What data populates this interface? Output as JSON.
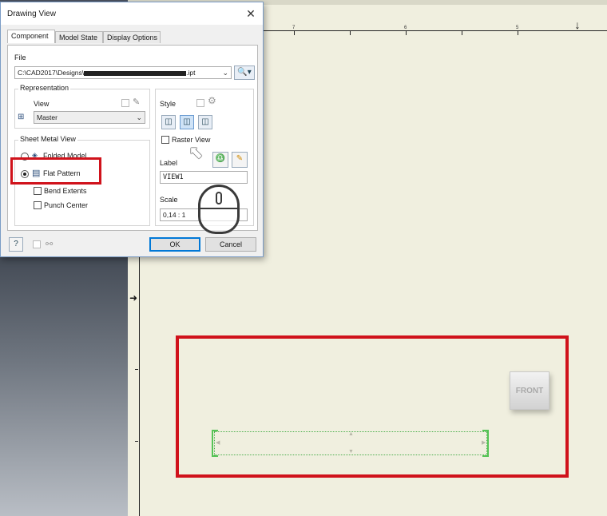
{
  "dialog": {
    "title": "Drawing View",
    "close_glyph": "✕",
    "tabs": [
      {
        "label": "Component"
      },
      {
        "label": "Model State"
      },
      {
        "label": "Display Options"
      }
    ],
    "file": {
      "label": "File",
      "value": "C:\\CAD2017\\Designs\\",
      "value_suffix": ".ipt"
    },
    "representation": {
      "title": "Representation",
      "view_label": "View",
      "view_value": "Master"
    },
    "sheet_metal_view": {
      "title": "Sheet Metal View",
      "folded_model_label": "Folded Model",
      "flat_pattern_label": "Flat Pattern",
      "bend_extents_label": "Bend Extents",
      "punch_center_label": "Punch Center"
    },
    "style": {
      "label": "Style",
      "raster_view_label": "Raster View"
    },
    "label_section": {
      "label": "Label",
      "value": "VIEW1"
    },
    "scale": {
      "label": "Scale",
      "value": "0,14 : 1"
    },
    "buttons": {
      "ok": "OK",
      "cancel": "Cancel"
    }
  },
  "canvas": {
    "ruler_numbers": [
      "7",
      "6",
      "5"
    ],
    "front_cube_label": "FRONT"
  },
  "colors": {
    "highlight_red": "#d0121b",
    "sheet_background": "#f0efdf",
    "preview_green": "#56c456"
  },
  "icons": [
    "close-icon",
    "folder-browse-icon",
    "view-representation-icon",
    "folded-model-icon",
    "flat-pattern-icon",
    "style-hidden-line-icon",
    "style-hidden-line-removed-icon",
    "style-shaded-icon",
    "label-visibility-icon",
    "edit-label-icon",
    "help-icon",
    "mouse-icon",
    "pointer-cursor-icon"
  ]
}
